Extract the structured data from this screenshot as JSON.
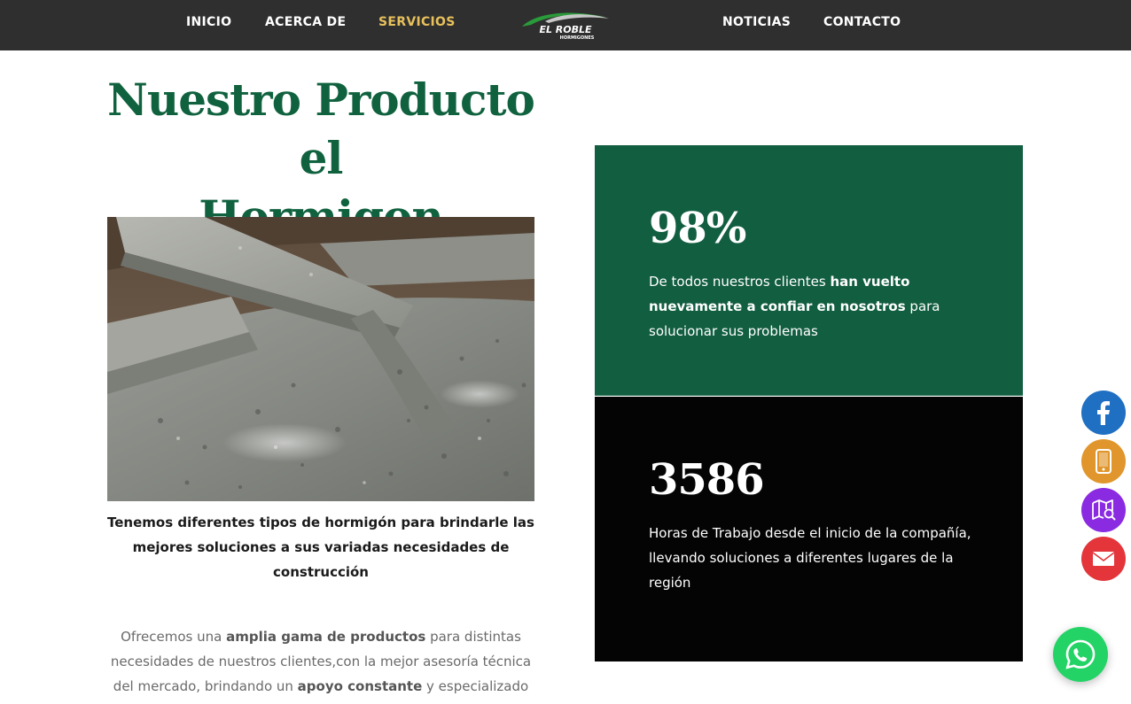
{
  "nav": {
    "items": [
      {
        "label": "INICIO",
        "active": false
      },
      {
        "label": "ACERCA DE",
        "active": false
      },
      {
        "label": "SERVICIOS",
        "active": true
      },
      {
        "label": "NOTICIAS",
        "active": false
      },
      {
        "label": "CONTACTO",
        "active": false
      }
    ],
    "logo": {
      "brand": "EL ROBLE",
      "sub": "HORMIGONES"
    },
    "active_color": "#e8c15c",
    "bar_color": "#2f2f2f"
  },
  "main": {
    "headline_line1": "Nuestro Producto el",
    "headline_line2": "Hormigon",
    "headline_color": "#10623f",
    "caption_line1": "Tenemos diferentes tipos de hormigón para brindarle las",
    "caption_line2": "mejores soluciones a sus variadas necesidades de",
    "caption_line3": "construcción",
    "body": {
      "p1_pre": "Ofrecemos una ",
      "p1_bold": "amplia gama de productos",
      "p1_post": " para distintas",
      "p2": "necesidades de nuestros clientes,con la mejor asesoría técnica",
      "p3_pre": "del mercado, brindando un ",
      "p3_bold": "apoyo constante",
      "p3_post": " y especializado"
    }
  },
  "stats": [
    {
      "number": "98%",
      "text_pre": "De todos nuestros clientes ",
      "text_bold": "han vuelto nuevamente a confiar en nosotros",
      "text_post": " para solucionar sus problemas",
      "bg": "#125e41"
    },
    {
      "number": "3586",
      "text": "Horas de Trabajo desde el inicio de la compañía, llevando soluciones a diferentes lugares de la región",
      "bg": "#040404"
    }
  ],
  "floating": {
    "buttons": [
      {
        "icon": "facebook-icon",
        "color": "#1f6fc2"
      },
      {
        "icon": "phone-icon",
        "color": "#e0962c"
      },
      {
        "icon": "map-search-icon",
        "color": "#8a2be2"
      },
      {
        "icon": "mail-icon",
        "color": "#e3353a"
      }
    ],
    "whatsapp": {
      "icon": "whatsapp-icon",
      "color": "#24d366"
    }
  }
}
